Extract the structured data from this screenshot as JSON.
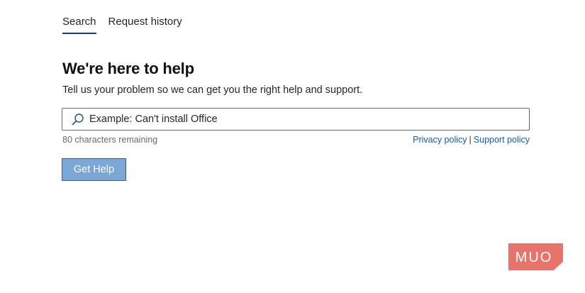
{
  "tabs": [
    {
      "label": "Search",
      "active": true
    },
    {
      "label": "Request history",
      "active": false
    }
  ],
  "main": {
    "heading": "We're here to help",
    "subheading": "Tell us your problem so we can get you the right help and support.",
    "search": {
      "placeholder": "Example: Can't install Office",
      "value": "",
      "icon": "search-icon"
    },
    "char_count": "80 characters remaining",
    "links": {
      "privacy": "Privacy policy",
      "separator": "|",
      "support": "Support policy"
    },
    "button_label": "Get Help"
  },
  "watermark": {
    "text": "MUO",
    "color": "#e8736b"
  },
  "colors": {
    "accent_underline": "#0f3c7a",
    "button_bg": "#7aa7d6",
    "link": "#0f5fb0"
  }
}
